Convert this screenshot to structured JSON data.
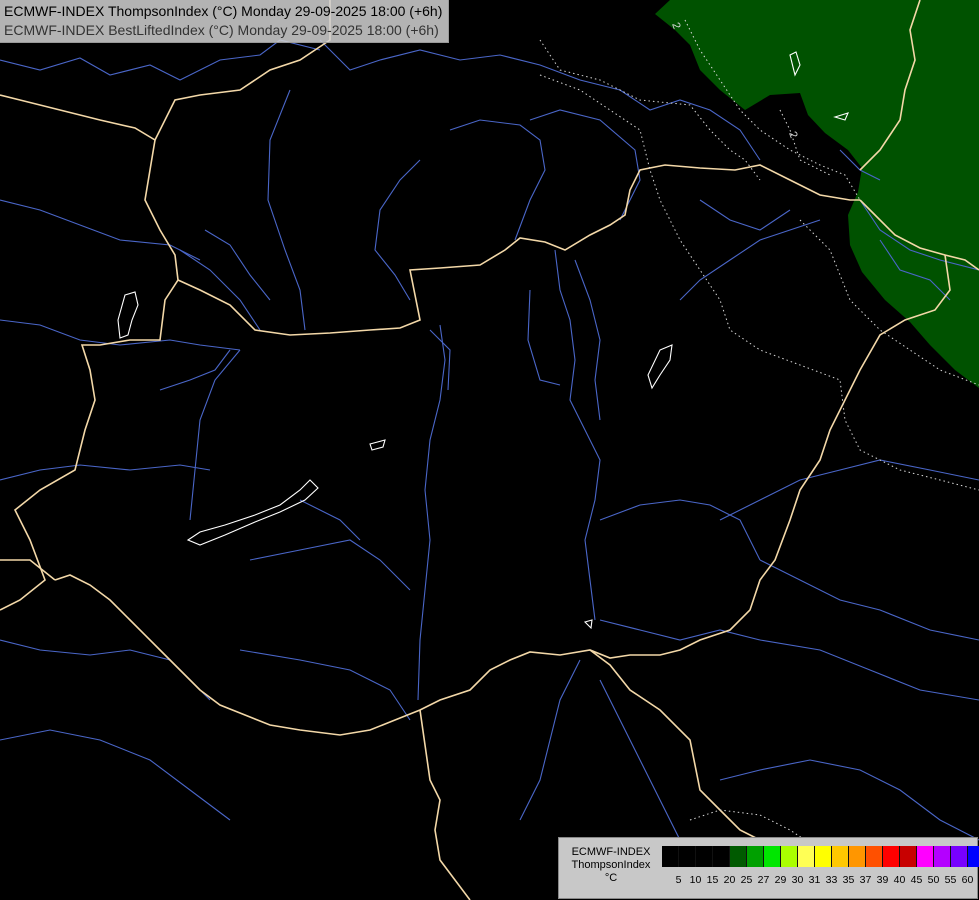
{
  "titles": {
    "line1": "ECMWF-INDEX ThompsonIndex (°C) Monday 29-09-2025 18:00 (+6h)",
    "line2": "ECMWF-INDEX BestLiftedIndex (°C) Monday 29-09-2025 18:00 (+6h)"
  },
  "contour_labels": [
    "2",
    "2"
  ],
  "legend": {
    "model": "ECMWF-INDEX",
    "parameter": "ThompsonIndex",
    "unit": "°C",
    "ticks": [
      "5",
      "10",
      "15",
      "20",
      "25",
      "27",
      "29",
      "30",
      "31",
      "33",
      "35",
      "37",
      "39",
      "40",
      "45",
      "50",
      "55",
      "60"
    ],
    "colors": [
      "#000000",
      "#000000",
      "#000000",
      "#000000",
      "#005a00",
      "#00a000",
      "#00e600",
      "#aaff00",
      "#ffff55",
      "#ffff00",
      "#ffc800",
      "#ff9600",
      "#ff5000",
      "#ff0000",
      "#c80000",
      "#ff00ff",
      "#b400ff",
      "#7800ff",
      "#0000ff"
    ]
  },
  "colors": {
    "background": "#000000",
    "shaded_area": "#005200",
    "rivers": "#4a66c8",
    "borders": "#f3d8a8",
    "lakes": "#ffffff",
    "contour": "#d8d8d8"
  }
}
